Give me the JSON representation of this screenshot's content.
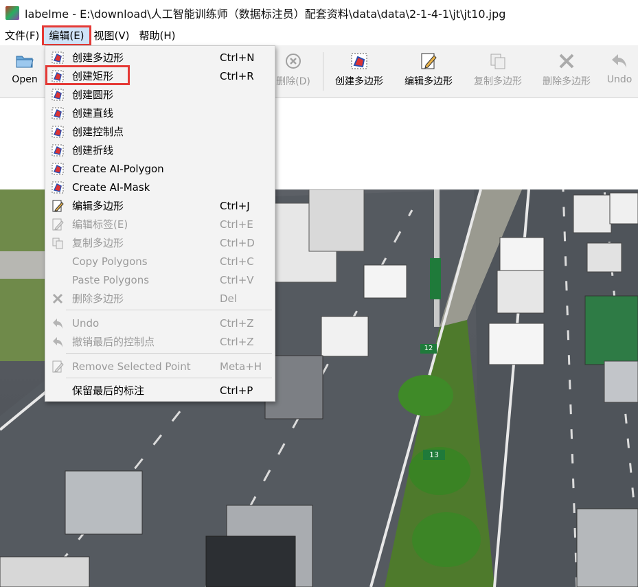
{
  "window": {
    "title": "labelme - E:\\download\\人工智能训练师（数据标注员）配套资料\\data\\data\\2-1-4-1\\jt\\jt10.jpg"
  },
  "menubar": {
    "items": [
      "文件(F)",
      "编辑(E)",
      "视图(V)",
      "帮助(H)"
    ]
  },
  "toolbar": {
    "open": "Open",
    "delete": "删除(D)",
    "create_polygon": "创建多边形",
    "edit_polygon": "编辑多边形",
    "copy_polygon": "复制多边形",
    "delete_polygon": "删除多边形",
    "undo": "Undo"
  },
  "edit_menu": {
    "items": [
      {
        "label": "创建多边形",
        "shortcut": "Ctrl+N"
      },
      {
        "label": "创建矩形",
        "shortcut": "Ctrl+R"
      },
      {
        "label": "创建圆形",
        "shortcut": ""
      },
      {
        "label": "创建直线",
        "shortcut": ""
      },
      {
        "label": "创建控制点",
        "shortcut": ""
      },
      {
        "label": "创建折线",
        "shortcut": ""
      },
      {
        "label": "Create AI-Polygon",
        "shortcut": ""
      },
      {
        "label": "Create AI-Mask",
        "shortcut": ""
      },
      {
        "label": "编辑多边形",
        "shortcut": "Ctrl+J"
      },
      {
        "label": "编辑标签(E)",
        "shortcut": "Ctrl+E"
      },
      {
        "label": "复制多边形",
        "shortcut": "Ctrl+D"
      },
      {
        "label": "Copy Polygons",
        "shortcut": "Ctrl+C"
      },
      {
        "label": "Paste Polygons",
        "shortcut": "Ctrl+V"
      },
      {
        "label": "删除多边形",
        "shortcut": "Del"
      },
      {
        "label": "Undo",
        "shortcut": "Ctrl+Z"
      },
      {
        "label": "撤销最后的控制点",
        "shortcut": "Ctrl+Z"
      },
      {
        "label": "Remove Selected Point",
        "shortcut": "Meta+H"
      },
      {
        "label": "保留最后的标注",
        "shortcut": "Ctrl+P"
      }
    ]
  },
  "canvas": {
    "sign_labels": [
      "12",
      "13"
    ]
  },
  "colors": {
    "highlight": "#e53935",
    "menu_bg": "#f3f3f3",
    "disabled_text": "#9a9a9a"
  }
}
